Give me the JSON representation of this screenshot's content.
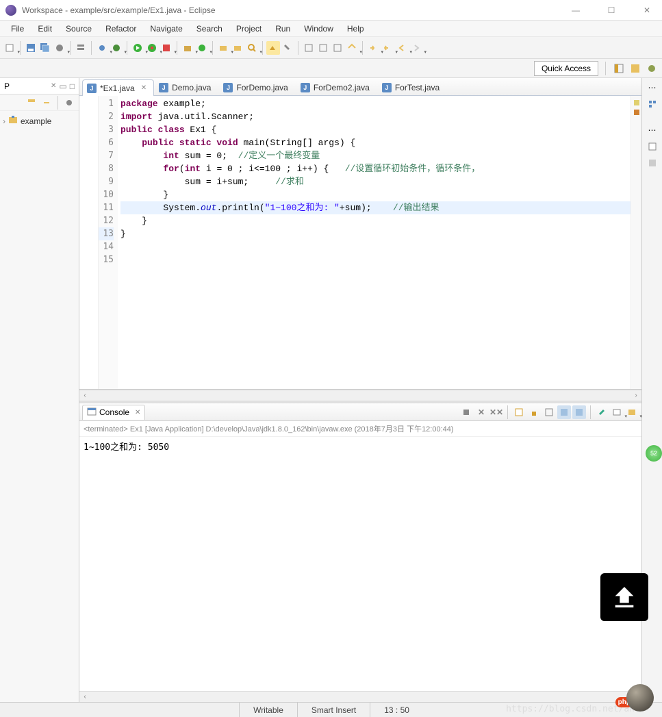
{
  "window": {
    "title": "Workspace - example/src/example/Ex1.java - Eclipse",
    "min": "—",
    "max": "☐",
    "close": "✕"
  },
  "menu": [
    "File",
    "Edit",
    "Source",
    "Refactor",
    "Navigate",
    "Search",
    "Project",
    "Run",
    "Window",
    "Help"
  ],
  "quick_access": "Quick Access",
  "project_explorer": {
    "tab_short": "P",
    "tree_root": "example"
  },
  "editor_tabs": [
    {
      "label": "*Ex1.java",
      "active": true,
      "dirty": true
    },
    {
      "label": "Demo.java",
      "active": false
    },
    {
      "label": "ForDemo.java",
      "active": false
    },
    {
      "label": "ForDemo2.java",
      "active": false
    },
    {
      "label": "ForTest.java",
      "active": false
    }
  ],
  "code": {
    "lines": [
      {
        "n": 1,
        "html": "<span class='kw'>package</span> example;"
      },
      {
        "n": 2,
        "html": ""
      },
      {
        "n": 3,
        "html": "<span class='kw'>import</span> java.util.Scanner;"
      },
      {
        "n": 6,
        "html": ""
      },
      {
        "n": 7,
        "html": "<span class='kw'>public class</span> Ex1 {"
      },
      {
        "n": 8,
        "html": "    <span class='kw'>public static void</span> main(String[] args) {"
      },
      {
        "n": 9,
        "html": "        <span class='kw'>int</span> sum = 0;  <span class='cm'>//定义一个最终变量</span>"
      },
      {
        "n": 10,
        "html": "        <span class='kw'>for</span>(<span class='kw'>int</span> i = 0 ; i&lt;=100 ; i++) {   <span class='cm'>//设置循环初始条件，循环条件，</span>"
      },
      {
        "n": 11,
        "html": "            sum = i+sum;     <span class='cm'>//求和</span>"
      },
      {
        "n": 12,
        "html": "        }"
      },
      {
        "n": 13,
        "html": "        System.<span class='stat'>out</span>.println(<span class='str'>\"1~100之和为: \"</span>+sum);    <span class='cm'>//输出结果</span>",
        "hl": true
      },
      {
        "n": 14,
        "html": "    }"
      },
      {
        "n": 15,
        "html": "}"
      }
    ]
  },
  "console": {
    "tab": "Console",
    "header": "<terminated> Ex1 [Java Application] D:\\develop\\Java\\jdk1.8.0_162\\bin\\javaw.exe (2018年7月3日 下午12:00:44)",
    "output": "1~100之和为: 5050"
  },
  "status": {
    "writable": "Writable",
    "insert": "Smart Insert",
    "pos": "13 : 50"
  },
  "watermark": "https://blog.csdn.net/an",
  "badge_green": "52",
  "php_badge": "php"
}
